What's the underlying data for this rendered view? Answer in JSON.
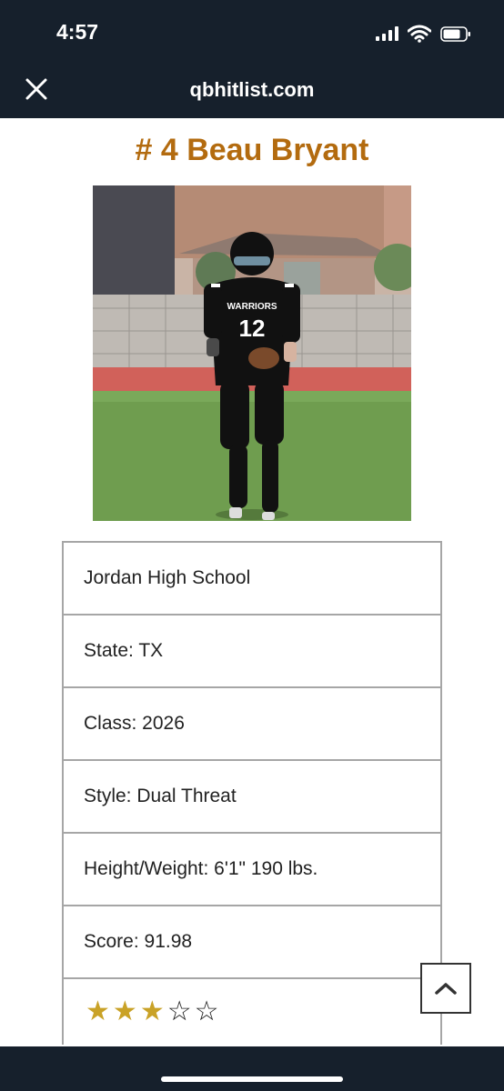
{
  "status_bar": {
    "time": "4:57"
  },
  "header": {
    "domain": "qbhitlist.com",
    "close_icon": "close-icon"
  },
  "player": {
    "title": "# 4 Beau Bryant",
    "photo_jersey_text": "WARRIORS",
    "photo_jersey_number": "12"
  },
  "info": {
    "school": "Jordan High School",
    "state": "State: TX",
    "class": "Class: 2026",
    "style": "Style: Dual Threat",
    "height_weight": "Height/Weight: 6'1\"  190 lbs.",
    "score": "Score: 91.98"
  },
  "rating": {
    "stars_filled": 3,
    "stars_total": 5,
    "filled_glyph": "★",
    "empty_glyph": "☆"
  },
  "colors": {
    "title": "#b36b0f",
    "bar": "#16202c",
    "star": "#c9a227",
    "border": "#a6a6a6"
  },
  "scroll_top_icon": "chevron-up-icon"
}
